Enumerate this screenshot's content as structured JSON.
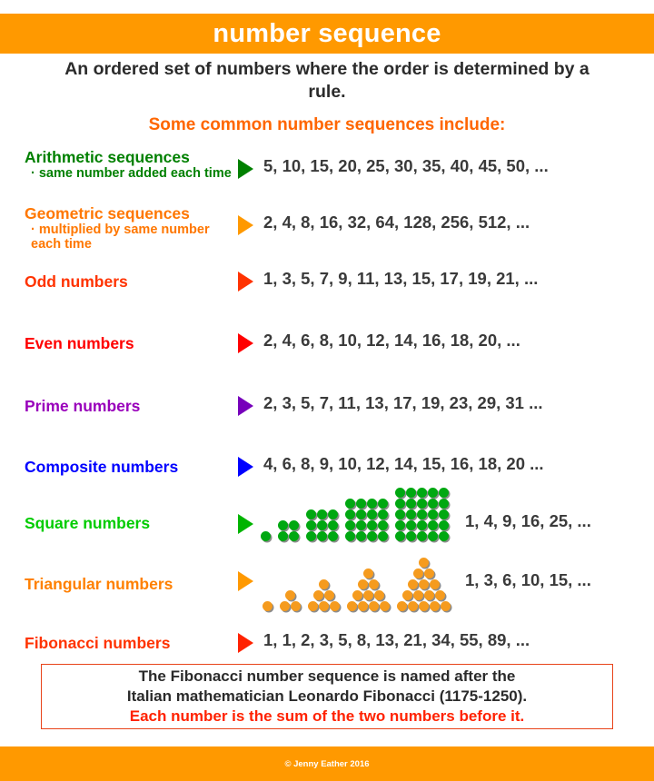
{
  "header": {
    "title": "number sequence",
    "background_color": "#FF9900"
  },
  "intro": {
    "definition": "An ordered set of numbers where the order is determined by a rule.",
    "subtitle": "Some common number sequences include:",
    "subtitle_color": "#FF6600"
  },
  "rows": [
    {
      "label": "Arithmetic sequences",
      "sub": "· same number added each time",
      "color": "#008000",
      "arrow_color": "#008000",
      "sequence": "5, 10, 15, 20, 25, 30, 35, 40, 45, 50, ..."
    },
    {
      "label": "Geometric sequences",
      "sub": "· multiplied by same number each time",
      "color": "#FF7700",
      "arrow_color": "#FF9900",
      "sequence": "2, 4, 8, 16, 32, 64, 128, 256, 512, ..."
    },
    {
      "label": "Odd numbers",
      "sub": "",
      "color": "#FF3300",
      "arrow_color": "#FF3300",
      "sequence": "1, 3, 5, 7, 9, 11, 13, 15, 17, 19, 21, ..."
    },
    {
      "label": "Even numbers",
      "sub": "",
      "color": "#FF0000",
      "arrow_color": "#FF0000",
      "sequence": "2, 4, 6, 8, 10, 12, 14, 16, 18, 20, ..."
    },
    {
      "label": "Prime numbers",
      "sub": "",
      "color": "#9900BB",
      "arrow_color": "#7700BB",
      "sequence": "2, 3, 5, 7, 11, 13, 17, 19, 23, 29, 31 ..."
    },
    {
      "label": "Composite numbers",
      "sub": "",
      "color": "#0000FF",
      "arrow_color": "#0000FF",
      "sequence": "4, 6, 8, 9, 10, 12, 14, 15, 16, 18, 20 ..."
    },
    {
      "label": "Square numbers",
      "sub": "",
      "color": "#00CC00",
      "arrow_color": "#00B400",
      "sequence": "1, 4, 9, 16, 25, ...",
      "figure": {
        "type": "square-dot-grids",
        "dot_color": "#00A811",
        "sizes": [
          1,
          2,
          3,
          4,
          5
        ]
      }
    },
    {
      "label": "Triangular numbers",
      "sub": "",
      "color": "#FF8000",
      "arrow_color": "#FF9900",
      "sequence": "1, 3, 6, 10, 15, ...",
      "figure": {
        "type": "triangular-dot-stacks",
        "dot_color": "#F59B1E",
        "sizes": [
          1,
          2,
          3,
          4,
          5
        ]
      }
    },
    {
      "label": "Fibonacci numbers",
      "sub": "",
      "color": "#FF3300",
      "arrow_color": "#FF2200",
      "sequence": "1, 1, 2, 3, 5, 8, 13, 21, 34, 55, 89, ..."
    }
  ],
  "info_box": {
    "border_color": "#E8431A",
    "line1": "The Fibonacci number sequence is named after the",
    "line2": "Italian mathematician Leonardo Fibonacci (1175-1250).",
    "line3": "Each number is the sum of the two numbers before it.",
    "line3_color": "#FF2200"
  },
  "footer": {
    "copyright": "© Jenny Eather 2016",
    "background_color": "#FF9900"
  }
}
